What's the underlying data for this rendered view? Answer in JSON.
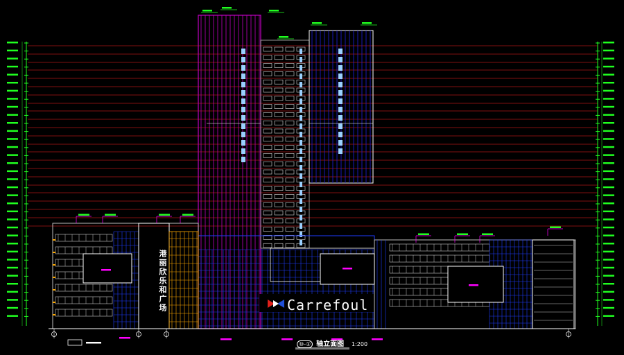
{
  "drawing": {
    "sign_text": "Carrefoul",
    "plaza_name": "港丽欣乐和广场",
    "title_axis": "⑩-①",
    "title_main": "轴立面图",
    "scale": "1:200"
  },
  "colors": {
    "background": "#000000",
    "tower_left": "#c000c0",
    "tower_right": "#2020e0",
    "podium_grid": "#1e3cff",
    "level_lines": "#ff2020",
    "dimension": "#20ff20",
    "accent_orange": "#ffaa00",
    "magenta": "#ff00ff",
    "white": "#ffffff"
  },
  "icons": {
    "brand_logo": "carrefour-logo-icon"
  }
}
